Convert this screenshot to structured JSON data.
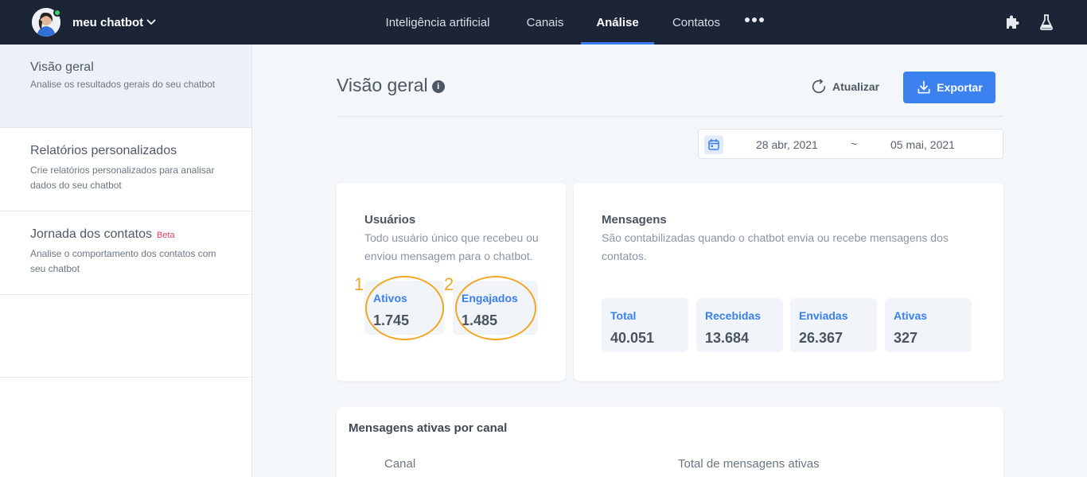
{
  "header": {
    "bot_name": "meu chatbot",
    "nav": [
      {
        "label": "Inteligência artificial"
      },
      {
        "label": "Canais"
      },
      {
        "label": "Análise"
      },
      {
        "label": "Contatos"
      }
    ],
    "active_nav": "Análise",
    "more_icon": "more-horizontal-icon",
    "icons": [
      "puzzle-icon",
      "flask-icon"
    ]
  },
  "sidebar": {
    "items": [
      {
        "title": "Visão geral",
        "desc": "Analise os resultados gerais do seu chatbot"
      },
      {
        "title": "Relatórios personalizados",
        "desc": "Crie relatórios personalizados para analisar dados do seu chatbot"
      },
      {
        "title": "Jornada dos contatos",
        "badge": "Beta",
        "desc": "Analise o comportamento dos contatos com seu chatbot"
      }
    ]
  },
  "main": {
    "title": "Visão geral",
    "info_icon": "i",
    "refresh_label": "Atualizar",
    "export_label": "Exportar",
    "date_start": "28 abr, 2021",
    "date_sep": "~",
    "date_end": "05 mai, 2021"
  },
  "users_card": {
    "title": "Usuários",
    "desc": "Todo usuário único que recebeu ou enviou mensagem para o chatbot.",
    "metrics": [
      {
        "label": "Ativos",
        "value": "1.745"
      },
      {
        "label": "Engajados",
        "value": "1.485"
      }
    ]
  },
  "messages_card": {
    "title": "Mensagens",
    "desc": "São contabilizadas quando o chatbot envia ou recebe mensagens dos contatos.",
    "metrics": [
      {
        "label": "Total",
        "value": "40.051"
      },
      {
        "label": "Recebidas",
        "value": "13.684"
      },
      {
        "label": "Enviadas",
        "value": "26.367"
      },
      {
        "label": "Ativas",
        "value": "327"
      }
    ]
  },
  "annotations": [
    "1",
    "2"
  ],
  "active_table": {
    "title": "Mensagens ativas por canal",
    "columns": [
      "Canal",
      "Total de mensagens ativas"
    ]
  },
  "colors": {
    "topbar": "#1c2536",
    "accent": "#3b82f0",
    "annotation": "#f0a724",
    "beta": "#e8425b",
    "online": "#3ecf6e"
  }
}
